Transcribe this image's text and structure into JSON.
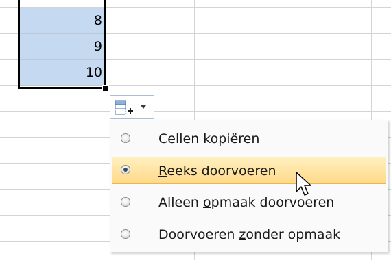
{
  "cells": [
    {
      "value": "8"
    },
    {
      "value": "9"
    },
    {
      "value": "10"
    }
  ],
  "autofill_button": {
    "icon": "autofill-options-icon",
    "arrow_icon": "dropdown-arrow-icon"
  },
  "menu": {
    "items": [
      {
        "pre": "",
        "mnemonic": "C",
        "post": "ellen kopiëren",
        "selected": false,
        "highlighted": false
      },
      {
        "pre": "",
        "mnemonic": "R",
        "post": "eeks doorvoeren",
        "selected": true,
        "highlighted": true
      },
      {
        "pre": "Alleen ",
        "mnemonic": "o",
        "post": "pmaak doorvoeren",
        "selected": false,
        "highlighted": false
      },
      {
        "pre": "Doorvoeren ",
        "mnemonic": "z",
        "post": "onder opmaak",
        "selected": false,
        "highlighted": false
      }
    ]
  },
  "colors": {
    "selection_fill": "#c5d9f1",
    "highlight": "#ffd98a",
    "menu_border": "#8ea8c8"
  }
}
